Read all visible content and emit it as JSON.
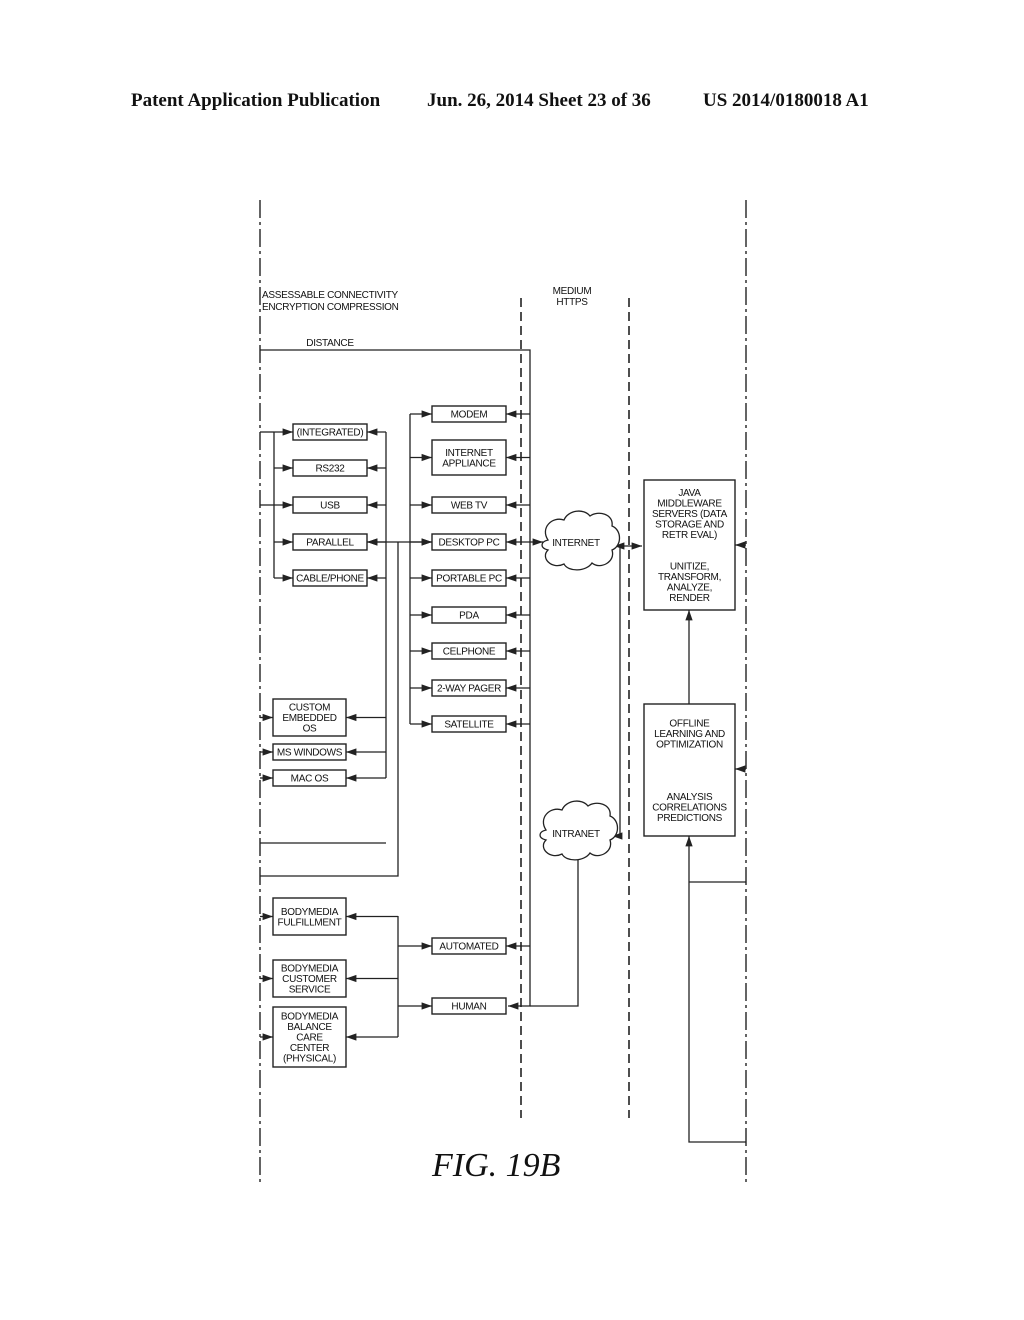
{
  "header": {
    "left": "Patent Application Publication",
    "center": "Jun. 26, 2014  Sheet 23 of 36",
    "right": "US 2014/0180018 A1"
  },
  "figure": {
    "caption": "FIG. 19B",
    "column_labels": {
      "assessable": [
        "ASSESSABLE CONNECTIVITY",
        "ENCRYPTION COMPRESSION"
      ],
      "medium": [
        "MEDIUM",
        "HTTPS"
      ],
      "distance": "DISTANCE"
    },
    "interfaces": [
      {
        "id": "integrated",
        "lines": [
          "(INTEGRATED)"
        ]
      },
      {
        "id": "rs232",
        "lines": [
          "RS232"
        ]
      },
      {
        "id": "usb",
        "lines": [
          "USB"
        ]
      },
      {
        "id": "parallel",
        "lines": [
          "PARALLEL"
        ]
      },
      {
        "id": "cable-phone",
        "lines": [
          "CABLE/PHONE"
        ]
      }
    ],
    "operating_systems": [
      {
        "id": "custom-embedded-os",
        "lines": [
          "CUSTOM",
          "EMBEDDED",
          "OS"
        ]
      },
      {
        "id": "ms-windows",
        "lines": [
          "MS WINDOWS"
        ]
      },
      {
        "id": "mac-os",
        "lines": [
          "MAC OS"
        ]
      }
    ],
    "devices": [
      {
        "id": "modem",
        "lines": [
          "MODEM"
        ]
      },
      {
        "id": "internet-appliance",
        "lines": [
          "INTERNET",
          "APPLIANCE"
        ]
      },
      {
        "id": "web-tv",
        "lines": [
          "WEB TV"
        ]
      },
      {
        "id": "desktop-pc",
        "lines": [
          "DESKTOP PC"
        ]
      },
      {
        "id": "portable-pc",
        "lines": [
          "PORTABLE PC"
        ]
      },
      {
        "id": "pda",
        "lines": [
          "PDA"
        ]
      },
      {
        "id": "celphone",
        "lines": [
          "CELPHONE"
        ]
      },
      {
        "id": "two-way-pager",
        "lines": [
          "2-WAY PAGER"
        ]
      },
      {
        "id": "satellite",
        "lines": [
          "SATELLITE"
        ]
      }
    ],
    "networks": [
      {
        "id": "internet",
        "label": "INTERNET"
      },
      {
        "id": "intranet",
        "label": "INTRANET"
      }
    ],
    "servers": [
      {
        "id": "java-middleware",
        "lines": [
          "JAVA",
          "MIDDLEWARE",
          "SERVERS (DATA",
          "STORAGE AND",
          "RETR EVAL)",
          "",
          "",
          "UNITIZE,",
          "TRANSFORM,",
          "ANALYZE,",
          "RENDER"
        ]
      },
      {
        "id": "offline-learning",
        "lines": [
          "OFFLINE",
          "LEARNING AND",
          "OPTIMIZATION",
          "",
          "",
          "",
          "",
          "ANALYSIS",
          "CORRELATIONS",
          "PREDICTIONS"
        ]
      }
    ],
    "services": [
      {
        "id": "automated",
        "lines": [
          "AUTOMATED"
        ]
      },
      {
        "id": "human",
        "lines": [
          "HUMAN"
        ]
      }
    ],
    "bodymedia": [
      {
        "id": "fulfillment",
        "lines": [
          "BODYMEDIA",
          "FULFILLMENT"
        ]
      },
      {
        "id": "customer-service",
        "lines": [
          "BODYMEDIA",
          "CUSTOMER",
          "SERVICE"
        ]
      },
      {
        "id": "balance-care-center",
        "lines": [
          "BODYMEDIA",
          "BALANCE",
          "CARE",
          "CENTER",
          "(PHYSICAL)"
        ]
      }
    ]
  }
}
